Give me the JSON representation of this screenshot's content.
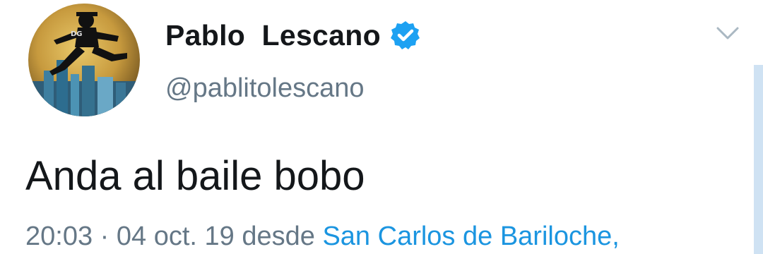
{
  "tweet": {
    "author": {
      "display_name": "Pablo  Lescano",
      "handle": "@pablitolescano",
      "verified": true,
      "avatar_icon": "avatar-silhouette-moon"
    },
    "text": "Anda al baile bobo",
    "meta": {
      "time": "20:03",
      "separator": "·",
      "date": "04 oct. 19",
      "source_prefix": "desde",
      "location": "San Carlos de Bariloche,"
    }
  },
  "icons": {
    "verified": "verified-badge-icon",
    "menu": "chevron-down-icon"
  },
  "colors": {
    "primary_text": "#14171a",
    "secondary_text": "#657786",
    "accent": "#1b95e0",
    "verified_badge": "#1da1f2"
  }
}
